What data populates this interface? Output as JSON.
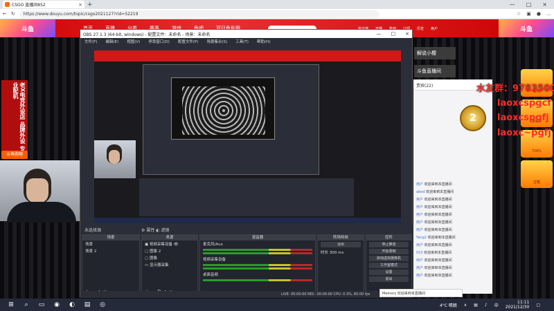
{
  "browser": {
    "tab_title": "CSGO 直播间852",
    "url": "https://www.douyu.com/topic/csgo2021127?rid=52219"
  },
  "site": {
    "banner_left": "斗鱼",
    "banner_right": "斗鱼",
    "nav": [
      "首页",
      "直播",
      "分类",
      "赛事",
      "游戏",
      "鱼吧",
      "双日鱼利用"
    ],
    "user_buttons": [
      "客户端",
      "开播",
      "签到",
      "订阅",
      "历史",
      "用户"
    ]
  },
  "left_banner": {
    "text": "老X电竞外设店 品牌外设 专业配机",
    "button": "斗鱼购物"
  },
  "right_side": {
    "box1": "解说小樱",
    "box2": "斗鱼直播间",
    "chat_header": "贵宾(22)",
    "chat_lines": [
      {
        "user": "用户",
        "msg": "欢迎来到本直播间"
      },
      {
        "user": "abed",
        "msg": "欢迎来到本直播间"
      },
      {
        "user": "用户",
        "msg": "欢迎来到本直播间"
      },
      {
        "user": "用户",
        "msg": "欢迎来到本直播间"
      },
      {
        "user": "用户",
        "msg": "欢迎来到本直播间"
      },
      {
        "user": "用户",
        "msg": "欢迎来到本直播间"
      },
      {
        "user": "用户",
        "msg": "欢迎来到本直播间"
      },
      {
        "user": "Yang2",
        "msg": "欢迎来到本直播间"
      },
      {
        "user": "用户",
        "msg": "欢迎来到本直播间"
      },
      {
        "user": "010",
        "msg": "欢迎来到本直播间"
      },
      {
        "user": "用户",
        "msg": "欢迎来到本直播间"
      },
      {
        "user": "用户",
        "msg": "欢迎来到本直播间"
      },
      {
        "user": "用户",
        "msg": "欢迎来到本直播间"
      }
    ],
    "overlay_group": "水友群：978350079",
    "overlay_lao": [
      "laoxcspgcf",
      "laoxcspgfj",
      "laoxc~pgfj"
    ],
    "medal_num": "2",
    "gifts": [
      "星光",
      "游戏卡",
      "TOP1",
      "宝箱"
    ],
    "float_msg": "Memory 欢迎来到本直播间"
  },
  "obs": {
    "title": "OBS 27.1.3 (64-bit, windows) - 配置文件：未命名 - 场景：未命名",
    "menu": [
      "文件(F)",
      "编辑(E)",
      "视图(V)",
      "停靠窗口(D)",
      "配置文件(P)",
      "场景集合(S)",
      "工具(T)",
      "帮助(H)"
    ],
    "scene_label": "未选择源",
    "filter_label": "属性",
    "filter_label2": "滤镜",
    "docks": {
      "scenes": {
        "title": "场景",
        "items": [
          "场景",
          "场景 2"
        ]
      },
      "sources": {
        "title": "来源",
        "items": [
          "视频采集设备",
          "图像 2",
          "图像",
          "显示器采集"
        ]
      },
      "mixer": {
        "title": "混音器",
        "tracks": [
          "麦克风/Aux",
          "视频采集设备",
          "桌面音频"
        ]
      },
      "transitions": {
        "title": "转场特效",
        "type": "淡出",
        "duration_label": "时长",
        "duration": "300 ms"
      },
      "controls": {
        "title": "控件",
        "buttons": [
          "停止推流",
          "开始录制",
          "启动虚拟摄像机",
          "工作室模式",
          "设置",
          "退出"
        ]
      }
    },
    "status": "LIVE: 00:00:00   REC: 00:00:00   CPU: 0.3%, 60.00 fps"
  },
  "taskbar": {
    "temp": "4°C 晴朗",
    "lang": "中",
    "time": "11:11",
    "date": "2021/12/30"
  }
}
